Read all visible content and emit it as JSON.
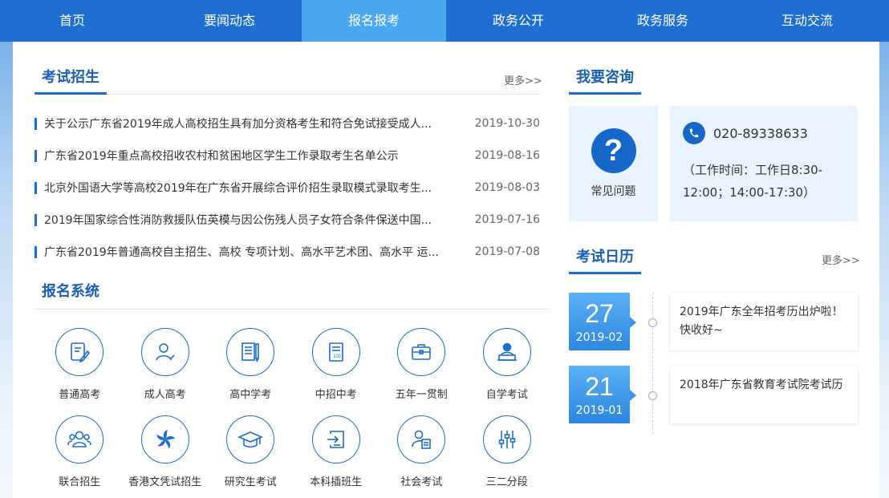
{
  "nav": {
    "items": [
      "首页",
      "要闻动态",
      "报名报考",
      "政务公开",
      "政务服务",
      "互动交流"
    ],
    "active_index": 2
  },
  "exam_recruit": {
    "title": "考试招生",
    "more": "更多>>",
    "news": [
      {
        "title": "关于公示广东省2019年成人高校招生具有加分资格考生和符合免试接受成人...",
        "date": "2019-10-30"
      },
      {
        "title": "广东省2019年重点高校招收农村和贫困地区学生工作录取考生名单公示",
        "date": "2019-08-16"
      },
      {
        "title": "北京外国语大学等高校2019年在广东省开展综合评价招生录取模式录取考生...",
        "date": "2019-08-03"
      },
      {
        "title": "2019年国家综合性消防救援队伍英模与因公伤残人员子女符合条件保送中国...",
        "date": "2019-07-16"
      },
      {
        "title": "广东省2019年普通高校自主招生、高校 专项计划、高水平艺术团、高水平 运...",
        "date": "2019-07-08"
      }
    ]
  },
  "registration": {
    "title": "报名系统",
    "items": [
      {
        "label": "普通高考",
        "icon": "document-pen-icon"
      },
      {
        "label": "成人高考",
        "icon": "user-pen-icon"
      },
      {
        "label": "高中学考",
        "icon": "notebook-icon"
      },
      {
        "label": "中招中考",
        "icon": "score-paper-icon"
      },
      {
        "label": "五年一贯制",
        "icon": "briefcase-icon"
      },
      {
        "label": "自学考试",
        "icon": "person-laptop-icon"
      },
      {
        "label": "联合招生",
        "icon": "group-icon"
      },
      {
        "label": "香港文凭试招生",
        "icon": "bauhinia-icon"
      },
      {
        "label": "研究生考试",
        "icon": "graduation-cap-icon"
      },
      {
        "label": "本科插班生",
        "icon": "transfer-icon"
      },
      {
        "label": "社会考试",
        "icon": "person-certificate-icon"
      },
      {
        "label": "三二分段",
        "icon": "sliders-icon"
      }
    ]
  },
  "consult": {
    "title": "我要咨询",
    "faq_label": "常见问题",
    "phone": "020-89338633",
    "hours": "（工作时间：工作日8:30-12:00；14:00-17:30）"
  },
  "calendar": {
    "title": "考试日历",
    "more": "更多>>",
    "events": [
      {
        "day": "27",
        "month": "2019-02",
        "text": "2019年广东全年招考历出炉啦！快收好~"
      },
      {
        "day": "21",
        "month": "2019-01",
        "text": "2018年广东省教育考试院考试历"
      }
    ]
  },
  "colors": {
    "nav_bg": "#1f6fd0",
    "nav_active": "#4aa8f0",
    "accent": "#1a6fc8"
  }
}
